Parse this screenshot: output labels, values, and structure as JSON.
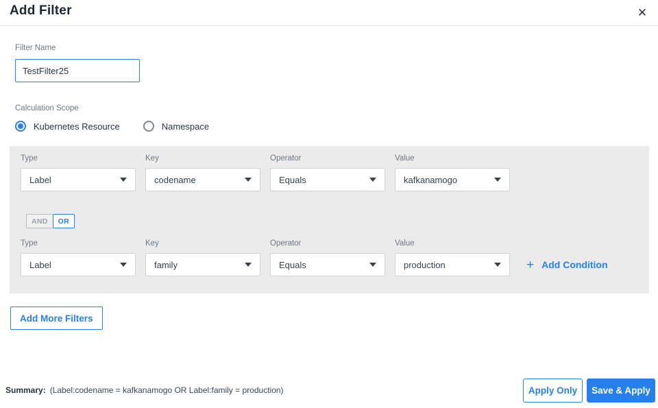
{
  "dialog": {
    "title": "Add Filter",
    "close_icon": "✕"
  },
  "filter_name": {
    "label": "Filter Name",
    "value": "TestFilter25"
  },
  "calculation_scope": {
    "label": "Calculation Scope",
    "options": [
      {
        "label": "Kubernetes Resource",
        "selected": true
      },
      {
        "label": "Namespace",
        "selected": false
      }
    ]
  },
  "conditions": {
    "columns": [
      "Type",
      "Key",
      "Operator",
      "Value"
    ],
    "rows": [
      {
        "type": "Label",
        "key": "codename",
        "operator": "Equals",
        "value": "kafkanamogo"
      },
      {
        "type": "Label",
        "key": "family",
        "operator": "Equals",
        "value": "production"
      }
    ],
    "logic_toggle": {
      "and_label": "AND",
      "or_label": "OR",
      "selected": "OR"
    },
    "add_condition": {
      "plus_icon": "+",
      "label": "Add Condition"
    }
  },
  "add_more_filters_label": "Add More Filters",
  "footer": {
    "summary_label": "Summary:",
    "summary_text": "(Label:codename = kafkanamogo OR Label:family = production)",
    "apply_only_label": "Apply Only",
    "save_apply_label": "Save & Apply"
  },
  "colors": {
    "accent_blue": "#2680eb",
    "panel_background": "#ebebeb",
    "field_border": "#d2d2d2",
    "label_gray": "#6e7883",
    "text_dark": "#2b3540"
  }
}
